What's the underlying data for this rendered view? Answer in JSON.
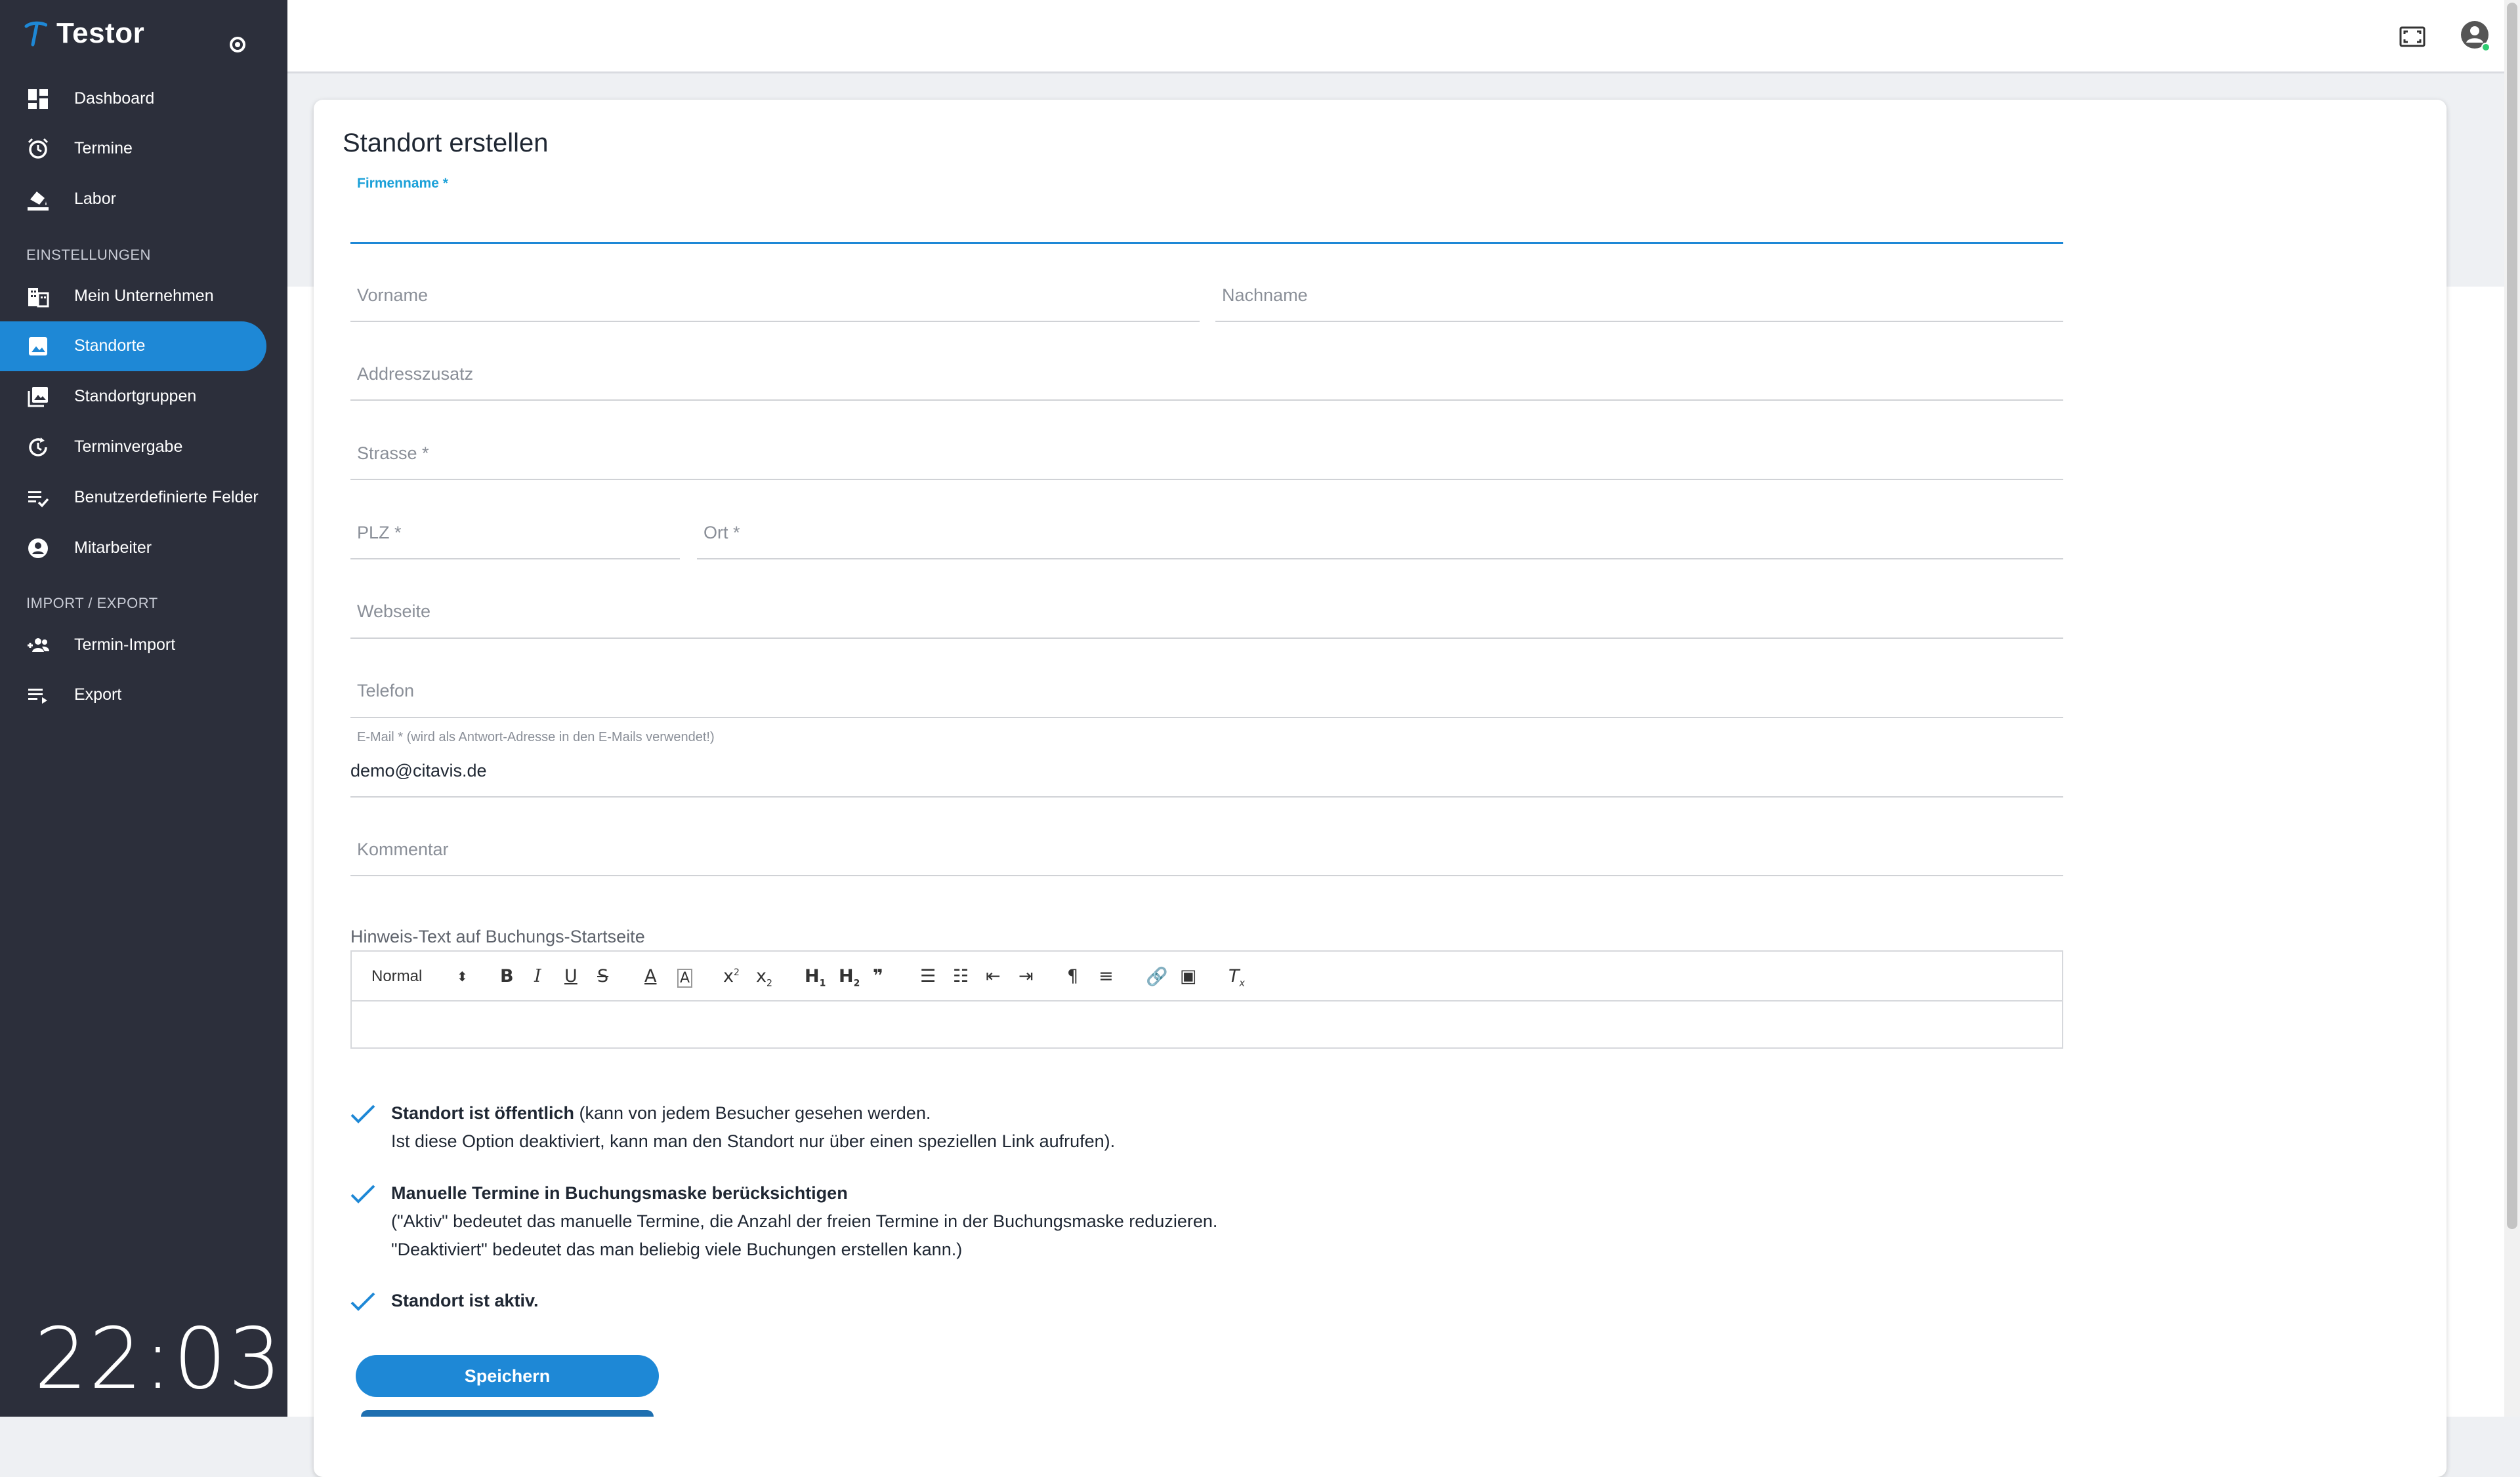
{
  "app": {
    "name": "Testor"
  },
  "sidebar": {
    "items": [
      {
        "label": "Dashboard"
      },
      {
        "label": "Termine"
      },
      {
        "label": "Labor"
      },
      {
        "label": "Mein Unternehmen"
      },
      {
        "label": "Standorte"
      },
      {
        "label": "Standortgruppen"
      },
      {
        "label": "Terminvergabe"
      },
      {
        "label": "Benutzerdefinierte Felder"
      },
      {
        "label": "Mitarbeiter"
      },
      {
        "label": "Termin-Import"
      },
      {
        "label": "Export"
      }
    ],
    "sections": {
      "settings": "EINSTELLUNGEN",
      "import_export": "IMPORT / EXPORT"
    },
    "clock": "22:03"
  },
  "form": {
    "title": "Standort erstellen",
    "firmenname_label": "Firmenname *",
    "vorname_label": "Vorname",
    "nachname_label": "Nachname",
    "addresszusatz_label": "Addresszusatz",
    "strasse_label": "Strasse *",
    "plz_label": "PLZ *",
    "ort_label": "Ort *",
    "webseite_label": "Webseite",
    "telefon_label": "Telefon",
    "email_label": "E-Mail * (wird als Antwort-Adresse in den E-Mails verwendet!)",
    "email_value": "demo@citavis.de",
    "kommentar_label": "Kommentar",
    "editor_label": "Hinweis-Text auf Buchungs-Startseite",
    "editor_format": "Normal"
  },
  "checkboxes": {
    "public_bold": "Standort ist öffentlich",
    "public_rest": " (kann von jedem Besucher gesehen werden.",
    "public_line2": "Ist diese Option deaktiviert, kann man den Standort nur über einen speziellen Link aufrufen).",
    "manual_bold": "Manuelle Termine in Buchungsmaske berücksichtigen",
    "manual_line2": "(\"Aktiv\" bedeutet das manuelle Termine, die Anzahl der freien Termine in der Buchungsmaske reduzieren.",
    "manual_line3": "\"Deaktiviert\" bedeutet das man beliebig viele Buchungen erstellen kann.)",
    "active_bold": "Standort ist aktiv."
  },
  "actions": {
    "save_label": "Speichern"
  },
  "colors": {
    "sidebar": "#2c2f3b",
    "accent": "#1e88d6"
  }
}
